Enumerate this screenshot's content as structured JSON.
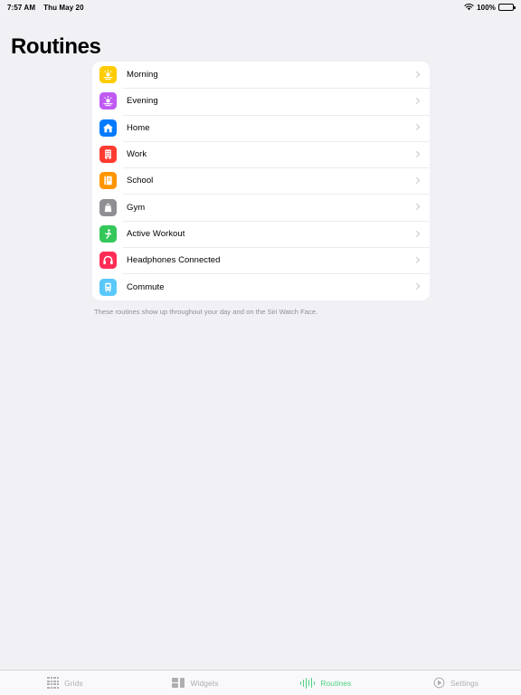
{
  "status_bar": {
    "time": "7:57 AM",
    "date": "Thu May 20",
    "wifi_icon": "wifi-icon",
    "battery_percent": "100%",
    "battery_icon": "battery-full-icon"
  },
  "header": {
    "title": "Routines"
  },
  "routines": {
    "footer_note": "These routines show up throughout your day and on the Siri Watch Face.",
    "items": [
      {
        "label": "Morning",
        "icon": "sunrise-icon",
        "color": "#ffcc00"
      },
      {
        "label": "Evening",
        "icon": "sunset-icon",
        "color": "#bf5af2"
      },
      {
        "label": "Home",
        "icon": "house-icon",
        "color": "#007aff"
      },
      {
        "label": "Work",
        "icon": "building-icon",
        "color": "#ff3b30"
      },
      {
        "label": "School",
        "icon": "book-icon",
        "color": "#ff9500"
      },
      {
        "label": "Gym",
        "icon": "gym-bag-icon",
        "color": "#8e8e93"
      },
      {
        "label": "Active Workout",
        "icon": "runner-icon",
        "color": "#34c759"
      },
      {
        "label": "Headphones Connected",
        "icon": "headphones-icon",
        "color": "#ff2d55"
      },
      {
        "label": "Commute",
        "icon": "tram-icon",
        "color": "#5ac8fa"
      }
    ]
  },
  "tab_bar": {
    "active_color": "#4cd080",
    "inactive_color": "#aeaeb2",
    "tabs": [
      {
        "label": "Grids",
        "icon": "grid-icon",
        "active": false
      },
      {
        "label": "Widgets",
        "icon": "widgets-icon",
        "active": false
      },
      {
        "label": "Routines",
        "icon": "waveform-icon",
        "active": true
      },
      {
        "label": "Settings",
        "icon": "clock-icon",
        "active": false
      }
    ]
  }
}
